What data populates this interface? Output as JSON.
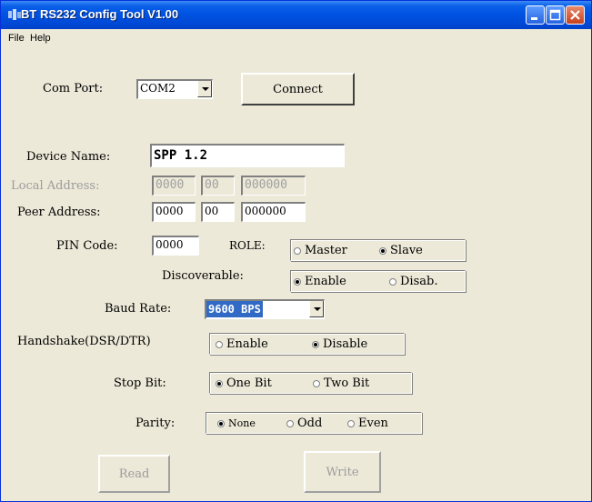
{
  "window": {
    "title": "BT RS232 Config Tool  V1.00"
  },
  "menu": {
    "file": "File",
    "help": "Help"
  },
  "com_port": {
    "label": "Com Port:",
    "value": "COM2",
    "connect_label": "Connect"
  },
  "device_name": {
    "label": "Device Name:",
    "value": "SPP 1.2"
  },
  "local_address": {
    "label": "Local Address:",
    "part1": "0000",
    "part2": "00",
    "part3": "000000"
  },
  "peer_address": {
    "label": "Peer Address:",
    "part1": "0000",
    "part2": "00",
    "part3": "000000"
  },
  "pin": {
    "label": "PIN Code:",
    "value": "0000"
  },
  "role": {
    "label": "ROLE:",
    "option1": "Master",
    "option2": "Slave",
    "selected": "Slave"
  },
  "discoverable": {
    "label": "Discoverable:",
    "option1": "Enable",
    "option2": "Disab.",
    "selected": "Enable"
  },
  "baud_rate": {
    "label": "Baud Rate:",
    "value": "9600 BPS"
  },
  "handshake": {
    "label": "Handshake(DSR/DTR)",
    "option1": "Enable",
    "option2": "Disable",
    "selected": "Disable"
  },
  "stop_bit": {
    "label": "Stop Bit:",
    "option1": "One Bit",
    "option2": "Two Bit",
    "selected": "One Bit"
  },
  "parity": {
    "label": "Parity:",
    "option1": "None",
    "option2": "Odd",
    "option3": "Even",
    "selected": "None"
  },
  "buttons": {
    "read": "Read",
    "write": "Write"
  },
  "colors": {
    "titlebar": "#0054e3",
    "dialog_bg": "#ece9d8",
    "selection": "#316ac5",
    "close_button": "#c7411d"
  }
}
